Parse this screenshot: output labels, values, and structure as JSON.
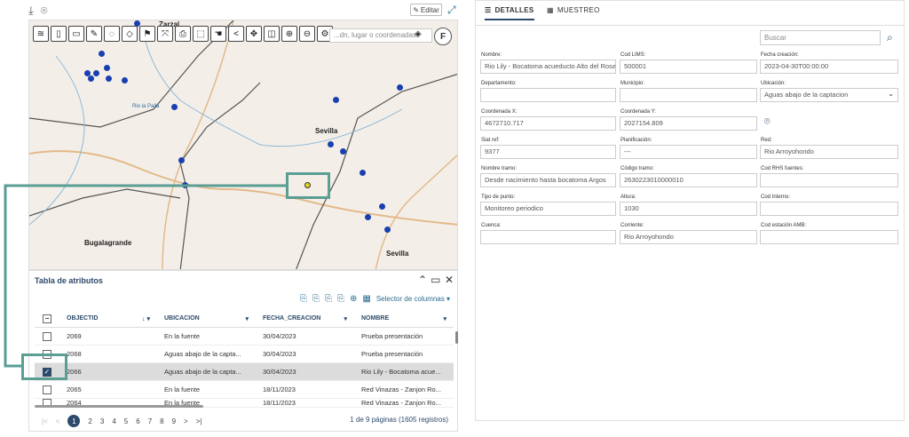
{
  "left": {
    "editar_label": "Editar",
    "map": {
      "search_placeholder": "...dn, lugar o coordenadas",
      "f_button": "F",
      "places": [
        "Zarzal",
        "Sevilla",
        "Bugalagrande",
        "Sevilla",
        "Rio la Paila"
      ]
    },
    "table": {
      "title": "Tabla de atributos",
      "column_selector": "Selector de columnas",
      "headers": [
        "OBJECTID",
        "UBICACION",
        "FECHA_CREACION",
        "NOMBRE"
      ],
      "rows": [
        {
          "id": "2069",
          "ubicacion": "En la fuente",
          "fecha": "30/04/2023",
          "nombre": "Prueba presentación",
          "checked": false
        },
        {
          "id": "2068",
          "ubicacion": "Aguas abajo de la capta...",
          "fecha": "30/04/2023",
          "nombre": "Prueba presentación",
          "checked": false
        },
        {
          "id": "2066",
          "ubicacion": "Aguas abajo de la capta...",
          "fecha": "30/04/2023",
          "nombre": "Rio Lily - Bocatoma acue...",
          "checked": true
        },
        {
          "id": "2065",
          "ubicacion": "En la fuente",
          "fecha": "18/11/2023",
          "nombre": "Red Vinazas - Zanjon Ro...",
          "checked": false
        },
        {
          "id": "2064",
          "ubicacion": "En la fuente",
          "fecha": "18/11/2023",
          "nombre": "Red Vinazas - Zanjon Ro...",
          "checked": false
        }
      ],
      "pages": [
        "2",
        "3",
        "4",
        "5",
        "6",
        "7",
        "8",
        "9"
      ],
      "current_page": "1",
      "page_info": "1 de 9 páginas (1605 registros)"
    }
  },
  "right": {
    "tabs": [
      "DETALLES",
      "MUESTREO"
    ],
    "search_placeholder": "Buscar",
    "fields": [
      {
        "label": "Nombre:",
        "value": "Rio Lily - Bocatoma acueducto Alto del Rosario"
      },
      {
        "label": "Cod LIMS:",
        "value": "500001"
      },
      {
        "label": "Fecha creación:",
        "value": "2023-04-30T00:00:00"
      },
      {
        "label": "Departamento:",
        "value": ""
      },
      {
        "label": "Municipio:",
        "value": ""
      },
      {
        "label": "Ubicación:",
        "value": "Aguas abajo de la captacion"
      },
      {
        "label": "Coordenada X:",
        "value": "4672710.717"
      },
      {
        "label": "Coordenada Y:",
        "value": "2027154.809"
      },
      {
        "label": "Siat ref:",
        "value": "9377"
      },
      {
        "label": "Planificación:",
        "value": "---"
      },
      {
        "label": "Red:",
        "value": "Rio Arroyohondo"
      },
      {
        "label": "Nombre tramo:",
        "value": "Desde nacimiento hasta bocatoma Argos"
      },
      {
        "label": "Código tramo:",
        "value": "2630223010000010"
      },
      {
        "label": "Cod RHS fuentes:",
        "value": ""
      },
      {
        "label": "Tipo de punto:",
        "value": "Monitoreo periodico"
      },
      {
        "label": "Altura:",
        "value": "1030"
      },
      {
        "label": "Cod Interno:",
        "value": ""
      },
      {
        "label": "Cuenca:",
        "value": ""
      },
      {
        "label": "Corriente:",
        "value": "Rio Arroyohondo"
      },
      {
        "label": "Cod estación AMB:",
        "value": ""
      }
    ]
  }
}
